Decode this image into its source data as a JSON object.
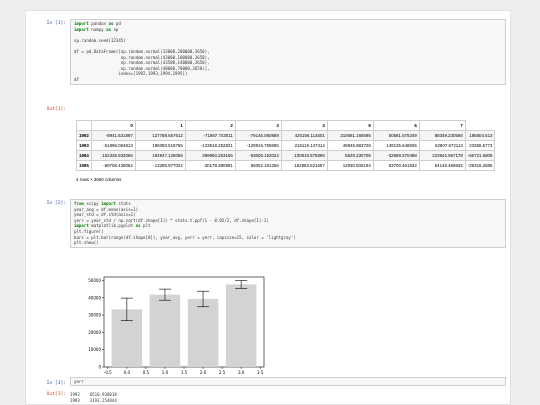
{
  "cells": [
    {
      "in_prompt": "In [1]:",
      "code": [
        [
          {
            "t": "import",
            "c": "kw"
          },
          {
            "t": " pandas ",
            "c": "plain"
          },
          {
            "t": "as",
            "c": "kw"
          },
          {
            "t": " pd",
            "c": "plain"
          }
        ],
        [
          {
            "t": "import",
            "c": "kw"
          },
          {
            "t": " numpy ",
            "c": "plain"
          },
          {
            "t": "as",
            "c": "kw"
          },
          {
            "t": " np",
            "c": "plain"
          }
        ],
        [],
        [
          {
            "t": "np.random.seed(12345)",
            "c": "plain"
          }
        ],
        [],
        [
          {
            "t": "df = pd.DataFrame([np.random.normal(32000,200000,3650),",
            "c": "plain"
          }
        ],
        [
          {
            "t": "                   np.random.normal(43000,100000,3650),",
            "c": "plain"
          }
        ],
        [
          {
            "t": "                   np.random.normal(43500,140000,3650),",
            "c": "plain"
          }
        ],
        [
          {
            "t": "                   np.random.normal(48000,70000,3650)],",
            "c": "plain"
          }
        ],
        [
          {
            "t": "                  index=[1992,1993,1994,1995])",
            "c": "plain"
          }
        ],
        [
          {
            "t": "df",
            "c": "plain"
          }
        ]
      ]
    },
    {
      "in_prompt": "In [2]:",
      "code": [
        [
          {
            "t": "from",
            "c": "kw"
          },
          {
            "t": " scipy ",
            "c": "plain"
          },
          {
            "t": "import",
            "c": "kw"
          },
          {
            "t": " stats",
            "c": "plain"
          }
        ],
        [
          {
            "t": "year_avg = df.mean(axis=1)",
            "c": "plain"
          }
        ],
        [
          {
            "t": "year_std = df.std(axis=1)",
            "c": "plain"
          }
        ],
        [
          {
            "t": "yerr = year_std / np.sqrt(df.shape[1]) * stats.t.ppf(1 - 0.05/2, df.shape[1]-1)",
            "c": "plain"
          }
        ],
        [
          {
            "t": "import",
            "c": "kw"
          },
          {
            "t": " matplotlib.pyplot ",
            "c": "plain"
          },
          {
            "t": "as",
            "c": "kw"
          },
          {
            "t": " plt",
            "c": "plain"
          }
        ],
        [
          {
            "t": "plt.figure()",
            "c": "plain"
          }
        ],
        [
          {
            "t": "bars = plt.bar(range(df.shape[0]), year_avg, yerr = yerr, capsize=15, color = 'lightgray')",
            "c": "plain"
          }
        ],
        [
          {
            "t": "plt.show()",
            "c": "plain"
          }
        ]
      ]
    },
    {
      "in_prompt": "In [3]:",
      "code": [
        [
          {
            "t": "yerr",
            "c": "plain"
          }
        ]
      ]
    }
  ],
  "out1": {
    "prompt": "Out[1]:",
    "columns": [
      "",
      "0",
      "1",
      "2",
      "3",
      "4",
      "5",
      "6",
      "7"
    ],
    "rows": [
      {
        "index": "1992",
        "values": [
          "-8941.531897",
          "127788.667612",
          "-71887.743011",
          "-79146.060869",
          "425156.114501",
          "310681.166595",
          "50581.575349",
          "88349.230566",
          "185804.513"
        ]
      },
      {
        "index": "1993",
        "values": [
          "-51896.094813",
          "198350.518755",
          "-123518.252821",
          "-129916.759685",
          "216119.147314",
          "49845.883728",
          "149135.648505",
          "62807.672113",
          "23365.5773"
        ]
      },
      {
        "index": "1994",
        "values": [
          "152336.932066",
          "192947.128056",
          "389950.263156",
          "-93006.152024",
          "100818.575896",
          "5529.230706",
          "-32989.370488",
          "223942.967178",
          "-66721.5808"
        ]
      },
      {
        "index": "1995",
        "values": [
          "-69708.439062",
          "-13289.977022",
          "-30178.390991",
          "55052.181256",
          "152883.621657",
          "12930.835194",
          "63700.461932",
          "64148.489835",
          "-29316.2685"
        ]
      }
    ],
    "note": "4 rows × 3650 columns"
  },
  "chart_data": {
    "type": "bar",
    "x": [
      0,
      1,
      2,
      3
    ],
    "values": [
      33300,
      41800,
      39300,
      47700
    ],
    "errors": [
      6500,
      3200,
      4500,
      2300
    ],
    "color": "#d3d3d3",
    "xlim": [
      -0.6,
      3.6
    ],
    "ylim": [
      0,
      52000
    ],
    "xticks": [
      "-0.5",
      "0.0",
      "0.5",
      "1.0",
      "1.5",
      "2.0",
      "2.5",
      "3.0",
      "3.5"
    ],
    "yticks": [
      "0",
      "10000",
      "20000",
      "30000",
      "40000",
      "50000"
    ],
    "title": "",
    "xlabel": "",
    "ylabel": ""
  },
  "out3": {
    "prompt": "Out[3]:",
    "lines": [
      "1992    6510.938018",
      "1993    3193.254844"
    ]
  }
}
